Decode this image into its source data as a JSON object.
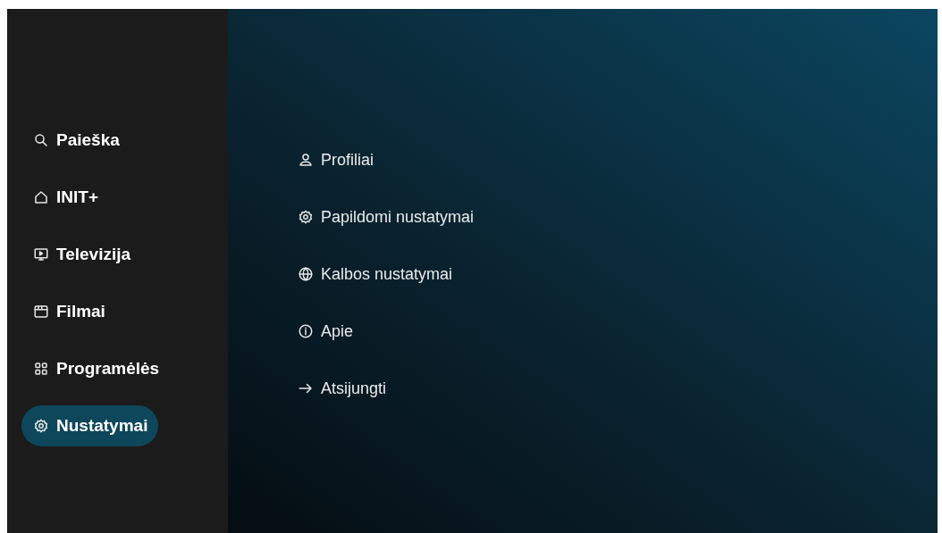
{
  "sidebar": {
    "items": [
      {
        "label": "Paieška",
        "kind": "search",
        "selected": false
      },
      {
        "label": "INIT+",
        "kind": "home",
        "selected": false
      },
      {
        "label": "Televizija",
        "kind": "tv",
        "selected": false
      },
      {
        "label": "Filmai",
        "kind": "film",
        "selected": false
      },
      {
        "label": "Programėlės",
        "kind": "apps",
        "selected": false
      },
      {
        "label": "Nustatymai",
        "kind": "gear",
        "selected": true
      }
    ]
  },
  "settings_menu": {
    "items": [
      {
        "label": "Profiliai",
        "kind": "user"
      },
      {
        "label": "Papildomi nustatymai",
        "kind": "gear"
      },
      {
        "label": "Kalbos nustatymai",
        "kind": "globe"
      },
      {
        "label": "Apie",
        "kind": "info"
      },
      {
        "label": "Atsijungti",
        "kind": "arrow"
      }
    ]
  }
}
